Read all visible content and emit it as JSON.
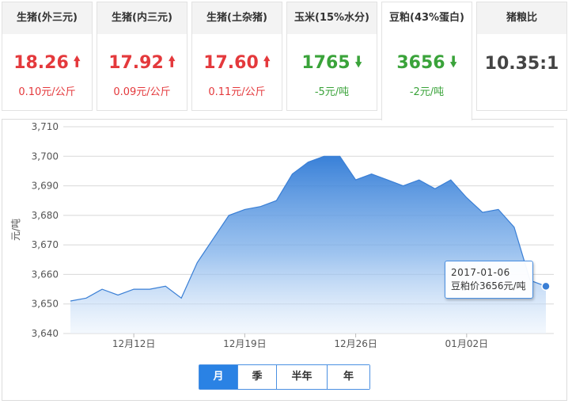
{
  "cards": [
    {
      "title": "生猪(外三元)",
      "price": "18.26",
      "change": "0.10元/公斤",
      "trend": "up"
    },
    {
      "title": "生猪(内三元)",
      "price": "17.92",
      "change": "0.09元/公斤",
      "trend": "up"
    },
    {
      "title": "生猪(土杂猪)",
      "price": "17.60",
      "change": "0.11元/公斤",
      "trend": "up"
    },
    {
      "title": "玉米(15%水分)",
      "price": "1765",
      "change": "-5元/吨",
      "trend": "down"
    },
    {
      "title": "豆粕(43%蛋白)",
      "price": "3656",
      "change": "-2元/吨",
      "trend": "down",
      "selected": true
    },
    {
      "title": "猪粮比",
      "price": "10.35:1",
      "change": "",
      "trend": "flat"
    }
  ],
  "icons": {
    "up": "arrow-up-icon",
    "down": "arrow-down-icon"
  },
  "colors": {
    "up": "#e4393c",
    "down": "#3aa33a",
    "line": "#3a7fd5",
    "accent": "#2a82e4"
  },
  "tooltip": {
    "date": "2017-01-06",
    "label": "豆粕价3656元/吨"
  },
  "period_buttons": [
    {
      "label": "月",
      "selected": true
    },
    {
      "label": "季"
    },
    {
      "label": "半年"
    },
    {
      "label": "年"
    }
  ],
  "chart_data": {
    "type": "area",
    "ylabel": "元/吨",
    "ylim": [
      3640,
      3710
    ],
    "yticks": [
      "3,640",
      "3,650",
      "3,660",
      "3,670",
      "3,680",
      "3,690",
      "3,700",
      "3,710"
    ],
    "xtick_labels": [
      "12月12日",
      "12月19日",
      "12月26日",
      "01月02日"
    ],
    "xtick_index": [
      4,
      11,
      18,
      25
    ],
    "grid": true,
    "series": [
      {
        "values": [
          3651,
          3652,
          3655,
          3653,
          3655,
          3655,
          3656,
          3652,
          3664,
          3672,
          3680,
          3682,
          3683,
          3685,
          3694,
          3698,
          3700,
          3700,
          3692,
          3694,
          3692,
          3690,
          3692,
          3689,
          3692,
          3686,
          3681,
          3682,
          3676,
          3658,
          3656
        ]
      }
    ]
  }
}
